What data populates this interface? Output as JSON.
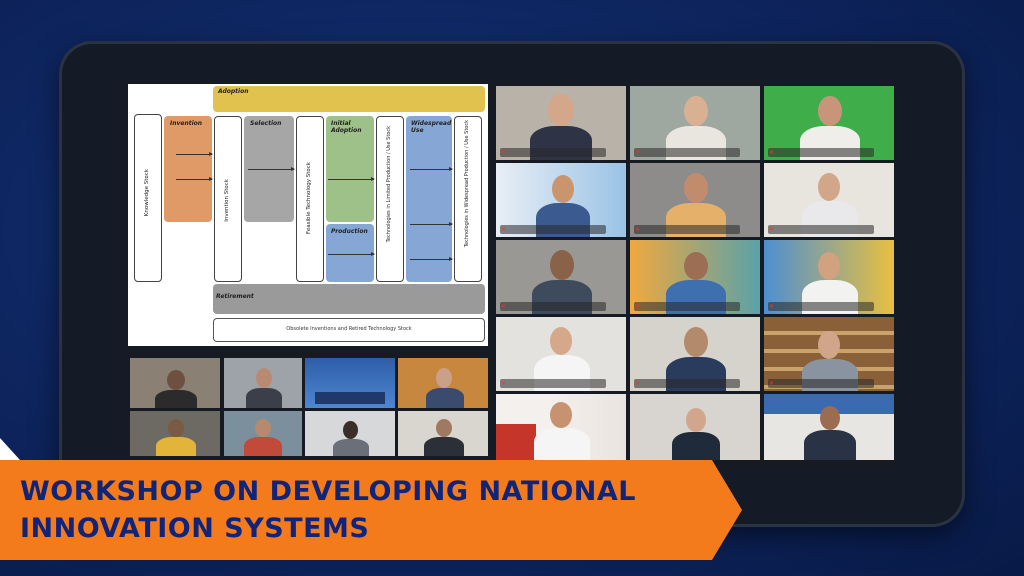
{
  "banner": {
    "line1": "WORKSHOP ON DEVELOPING NATIONAL",
    "line2": "INNOVATION SYSTEMS"
  },
  "slide": {
    "adoption": "Adoption",
    "invention": "Invention",
    "selection": "Selection",
    "initial_adoption": "Initial Adoption",
    "widespread_use": "Widespread Use",
    "production": "Production",
    "retirement": "Retirement",
    "obsolete": "Obsolete Inventions and Retired Technology Stock",
    "knowledge_stock": "Knowledge Stock",
    "invention_stock": "Invention Stock",
    "feasible_stock": "Feasible Technology Stock",
    "limited_stock": "Technologies in Limited Production / Use Stock",
    "widespread_stock": "Technologies in Widespread Production / Use Stock"
  },
  "colors": {
    "banner": "#f47b1c",
    "banner_text": "#10257a",
    "active_speaker": "#f2e35b",
    "mic_muted": "#e53935"
  }
}
